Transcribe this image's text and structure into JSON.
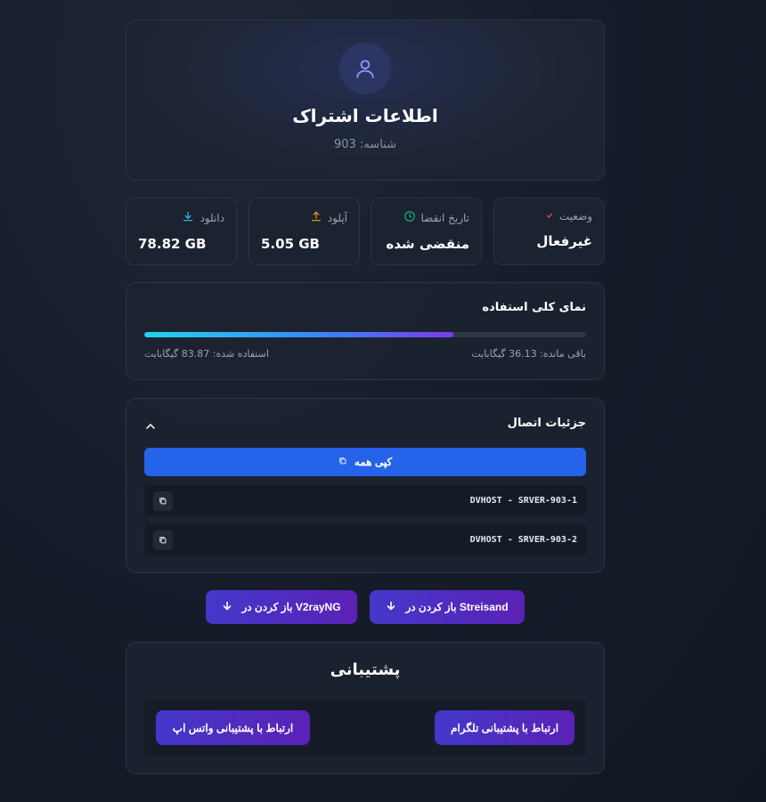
{
  "profile": {
    "title": "اطلاعات اشتراک",
    "id_text": "شناسه: 903",
    "avatar_icon": "user-icon"
  },
  "stats": [
    {
      "label": "وضعیت",
      "value": "غیرفعال",
      "icon": "check-icon",
      "color": "#f43f5e"
    },
    {
      "label": "تاریخ انقضا",
      "value": "منقضی شده",
      "icon": "clock-icon",
      "color": "#10b981"
    },
    {
      "label": "آپلود",
      "value": "5.05 GB",
      "icon": "upload-icon",
      "color": "#f59e0b"
    },
    {
      "label": "دانلود",
      "value": "78.82 GB",
      "icon": "download-icon",
      "color": "#38bdf8"
    }
  ],
  "usage": {
    "title": "نمای کلی استفاده",
    "used_text": "استفاده شده: 83.87 گیگابایت",
    "remaining_text": "باقی مانده: 36.13 گیگابایت",
    "used_fraction": 0.699
  },
  "connection": {
    "title": "جزئیات اتصال",
    "copy_all_label": "کپی همه",
    "configs": [
      "DVHOST - SRVER-903-1",
      "DVHOST - SRVER-903-2"
    ]
  },
  "open_buttons": {
    "streisand": "Streisand باز کردن در",
    "v2rayng": "V2rayNG باز کردن در"
  },
  "support": {
    "title": "پشتیبانی",
    "telegram_label": "ارتباط با پشتیبانی تلگرام",
    "whatsapp_label": "ارتباط با پشتیبانی واتس اپ"
  }
}
